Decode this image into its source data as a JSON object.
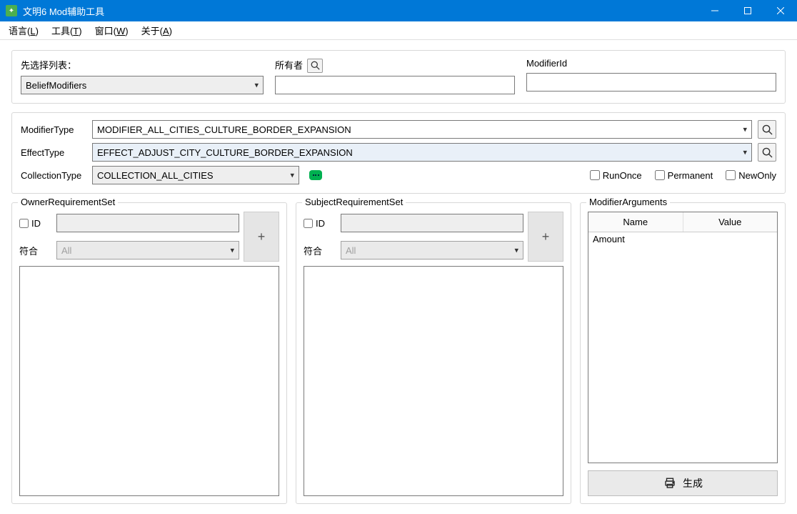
{
  "window": {
    "title": "文明6 Mod辅助工具"
  },
  "menu": {
    "language": "语言",
    "language_key": "L",
    "tools": "工具",
    "tools_key": "T",
    "window": "窗口",
    "window_key": "W",
    "about": "关于",
    "about_key": "A"
  },
  "top": {
    "preselect_label": "先选择列表：",
    "preselect_value": "BeliefModifiers",
    "owner_label": "所有者",
    "owner_value": "",
    "modifier_id_label": "ModifierId",
    "modifier_id_value": ""
  },
  "main": {
    "modifier_type_label": "ModifierType",
    "modifier_type_value": "MODIFIER_ALL_CITIES_CULTURE_BORDER_EXPANSION",
    "effect_type_label": "EffectType",
    "effect_type_value": "EFFECT_ADJUST_CITY_CULTURE_BORDER_EXPANSION",
    "collection_type_label": "CollectionType",
    "collection_type_value": "COLLECTION_ALL_CITIES",
    "run_once_label": "RunOnce",
    "permanent_label": "Permanent",
    "new_only_label": "NewOnly"
  },
  "owner_req": {
    "title": "OwnerRequirementSet",
    "id_label": "ID",
    "id_value": "",
    "match_label": "符合",
    "match_value": "All"
  },
  "subject_req": {
    "title": "SubjectRequirementSet",
    "id_label": "ID",
    "id_value": "",
    "match_label": "符合",
    "match_value": "All"
  },
  "args": {
    "title": "ModifierArguments",
    "col_name": "Name",
    "col_value": "Value",
    "rows": [
      {
        "name": "Amount",
        "value": ""
      }
    ]
  },
  "generate": {
    "label": "生成"
  }
}
